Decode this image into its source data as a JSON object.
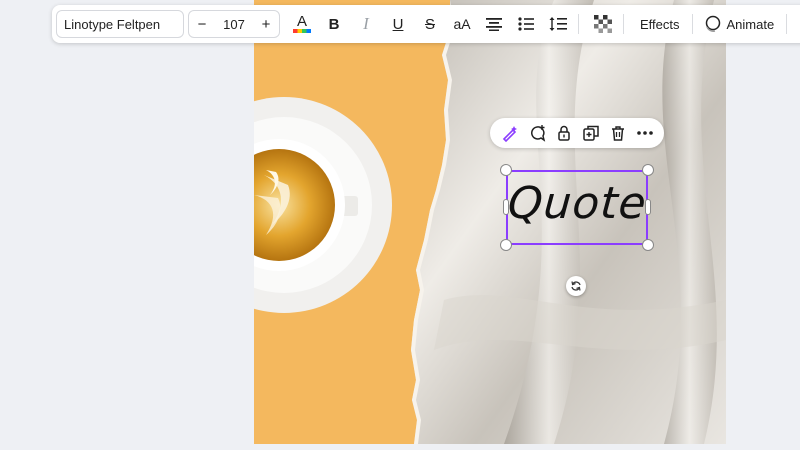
{
  "toolbar": {
    "font_name": "Linotype Feltpen",
    "font_size": "107",
    "minus_label": "−",
    "plus_label": "+",
    "bold_label": "B",
    "italic_label": "I",
    "underline_label": "U",
    "strike_label": "S",
    "case_label": "aA",
    "effects_label": "Effects",
    "animate_label": "Animate",
    "text_color_letter": "A",
    "text_color_bar": [
      "#ff3b30",
      "#ffcc00",
      "#34c759",
      "#007aff"
    ]
  },
  "canvas": {
    "text_element": "Quote",
    "selection_color": "#8b3dff",
    "background_color": "#f4b85e"
  },
  "mini_toolbar": {
    "icons": [
      "magic-edit-icon",
      "comment-icon",
      "lock-icon",
      "duplicate-icon",
      "delete-icon",
      "more-icon"
    ]
  }
}
